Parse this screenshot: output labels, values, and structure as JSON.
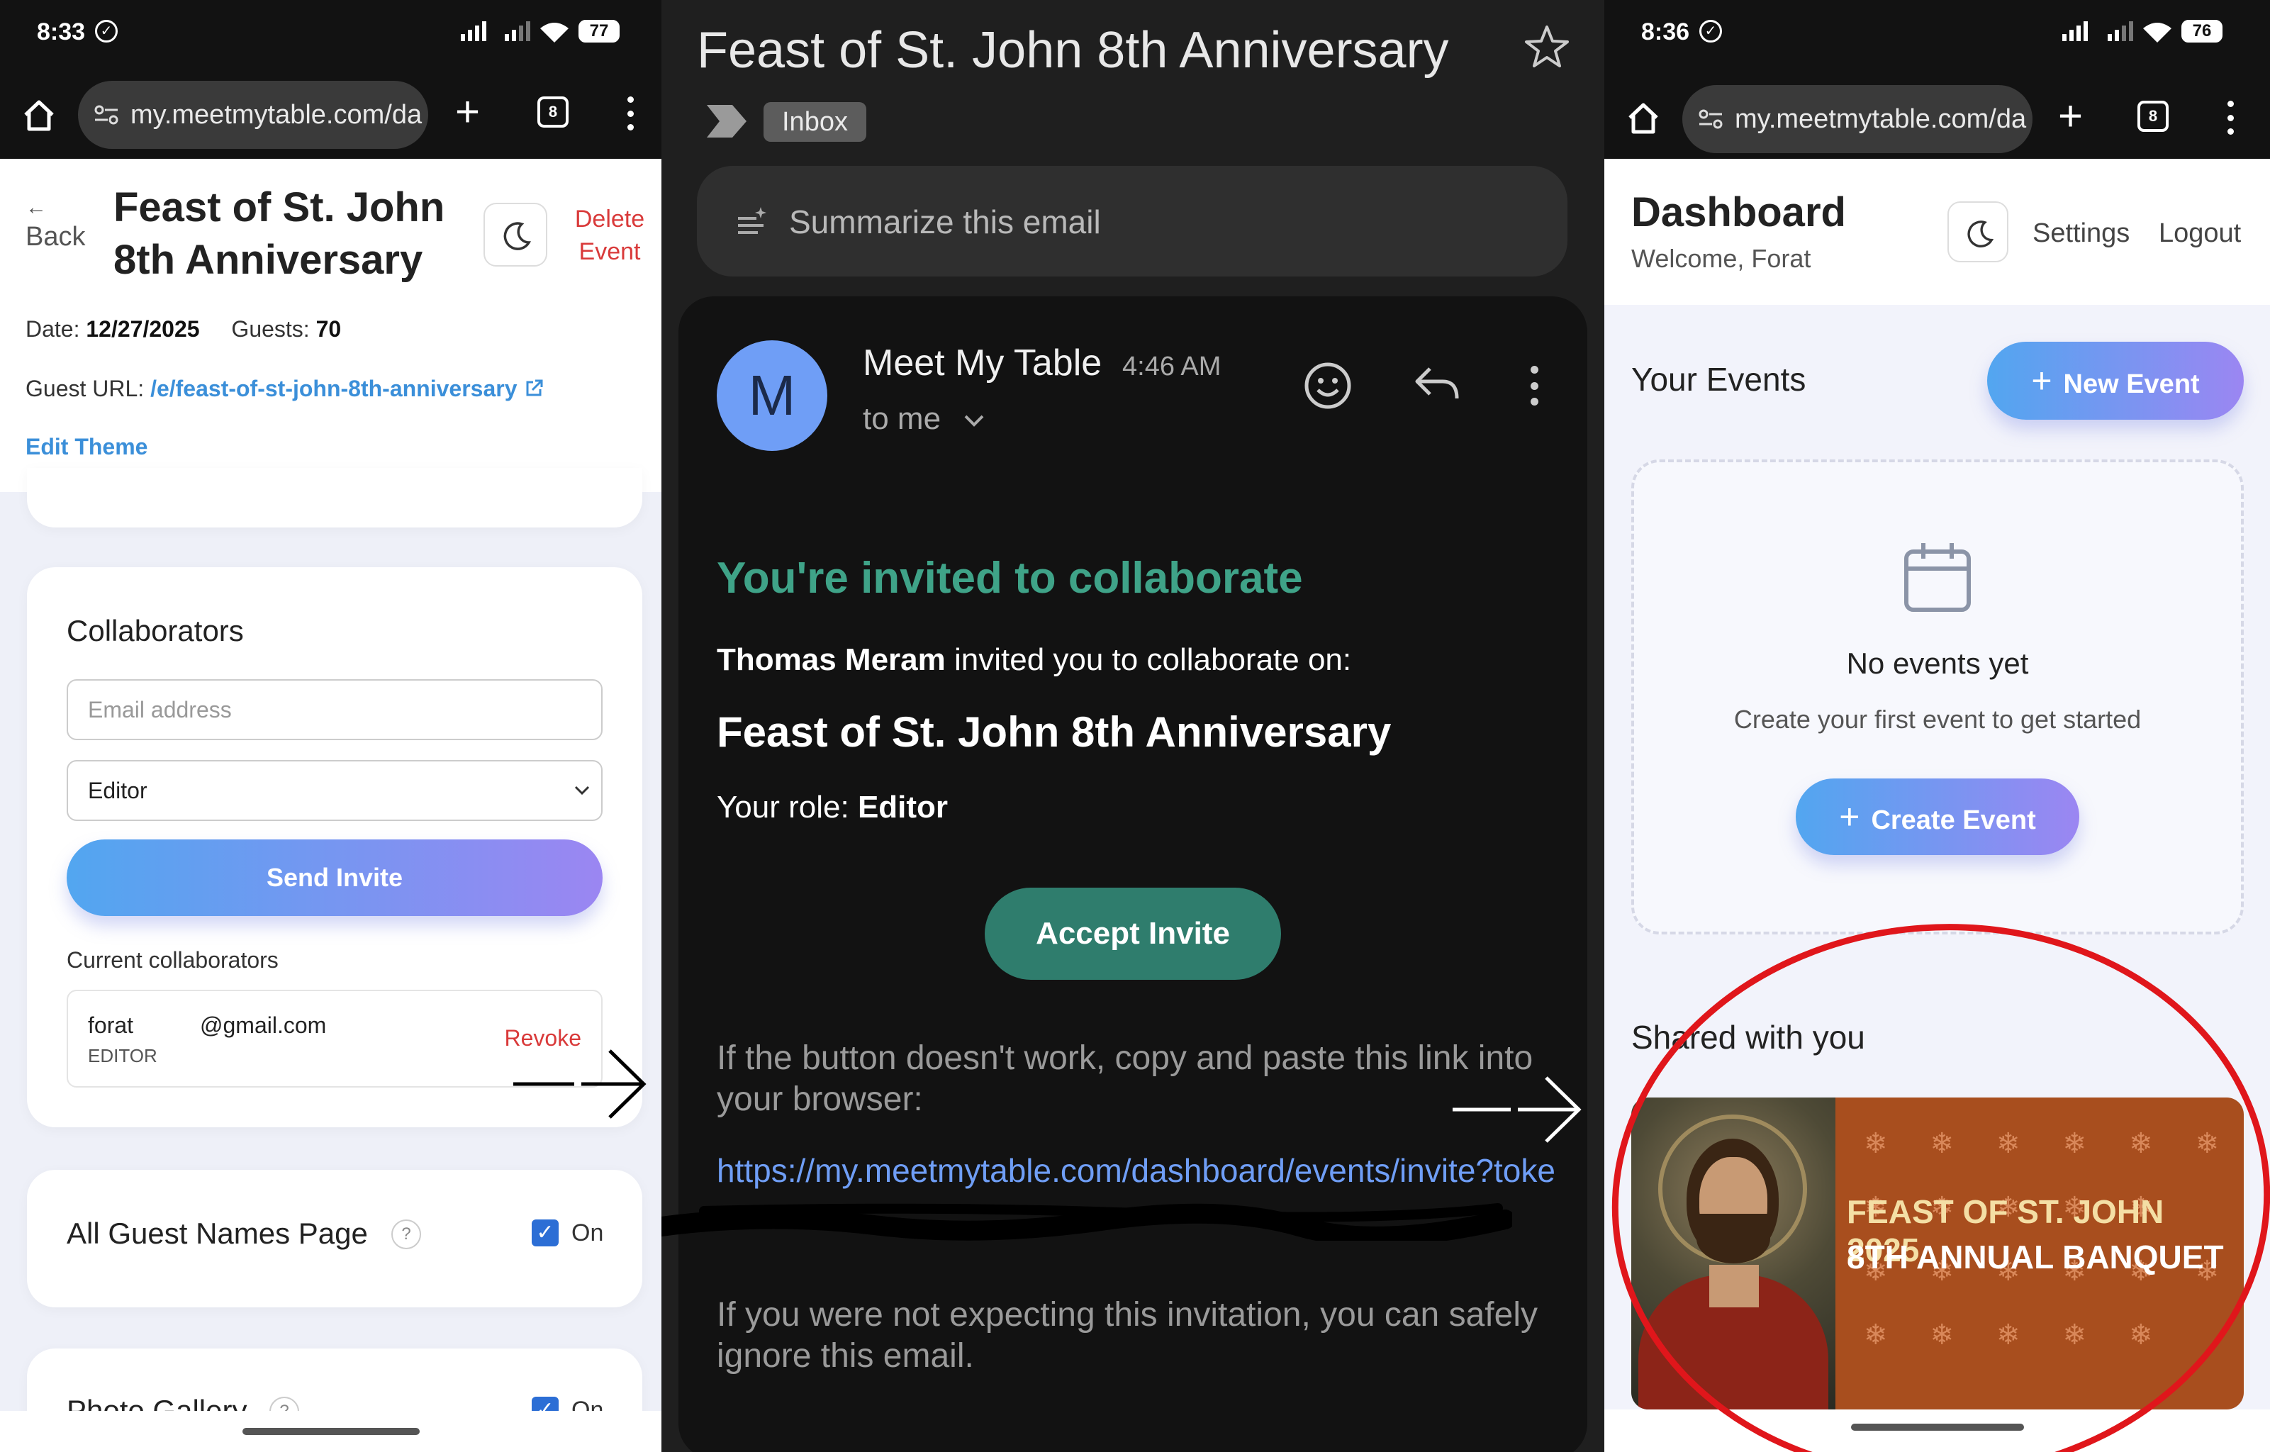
{
  "panel1": {
    "status": {
      "time": "8:33",
      "battery": "77"
    },
    "browser": {
      "url": "my.meetmytable.com/da",
      "tab_count": "8"
    },
    "header": {
      "back_arrow": "←",
      "back": "Back",
      "title_line1": "Feast of St. John",
      "title_line2": "8th Anniversary",
      "delete_line1": "Delete",
      "delete_line2": "Event"
    },
    "meta": {
      "date_label": "Date:",
      "date": "12/27/2025",
      "guests_label": "Guests:",
      "guests": "70",
      "url_label": "Guest URL:",
      "url": "/e/feast-of-st-john-8th-anniversary",
      "edit_theme": "Edit Theme"
    },
    "collaborators": {
      "heading": "Collaborators",
      "email_placeholder": "Email address",
      "role": "Editor",
      "send_invite": "Send Invite",
      "current_label": "Current collaborators",
      "items": [
        {
          "name": "forat",
          "email": "@gmail.com",
          "role": "EDITOR",
          "action": "Revoke"
        }
      ]
    },
    "settings": [
      {
        "label": "All Guest Names Page",
        "help": "?",
        "state": "On"
      },
      {
        "label": "Photo Gallery",
        "help": "?",
        "state": "On"
      }
    ]
  },
  "panel2": {
    "subject": "Feast of St. John 8th Anniversary",
    "label": "Inbox",
    "summarize": "Summarize this email",
    "sender": {
      "initial": "M",
      "name": "Meet My Table",
      "time": "4:46 AM",
      "to": "to me"
    },
    "body": {
      "heading": "You're invited to collaborate",
      "inviter": "Thomas Meram",
      "invite_text": " invited you to collaborate on:",
      "event": "Feast of St. John 8th Anniversary",
      "role_label": "Your role: ",
      "role": "Editor",
      "accept": "Accept Invite",
      "fallback": "If the button doesn't work, copy and paste this link into your browser:",
      "link": "https://my.meetmytable.com/dashboard/events/invite?toke",
      "footer": "If you were not expecting this invitation, you can safely ignore this email."
    }
  },
  "panel3": {
    "status": {
      "time": "8:36",
      "battery": "76"
    },
    "browser": {
      "url": "my.meetmytable.com/da",
      "tab_count": "8"
    },
    "header": {
      "title": "Dashboard",
      "welcome": "Welcome, Forat",
      "settings": "Settings",
      "logout": "Logout"
    },
    "events": {
      "heading": "Your Events",
      "new_event": "New Event",
      "empty_title": "No events yet",
      "empty_text": "Create your first event to get started",
      "create_event": "Create Event"
    },
    "shared": {
      "heading": "Shared with you",
      "banner_line1": "FEAST OF ST. JOHN 2025",
      "banner_line2": "8TH ANNUAL BANQUET"
    }
  },
  "colors": {
    "accent_blue": "#3b8fd9",
    "gradient_start": "#52a6f0",
    "gradient_end": "#9b86f2",
    "delete_red": "#d93a3a",
    "email_green": "#2f7d6d",
    "heading_teal": "#3fa388",
    "annotation_red": "#e0161b"
  }
}
